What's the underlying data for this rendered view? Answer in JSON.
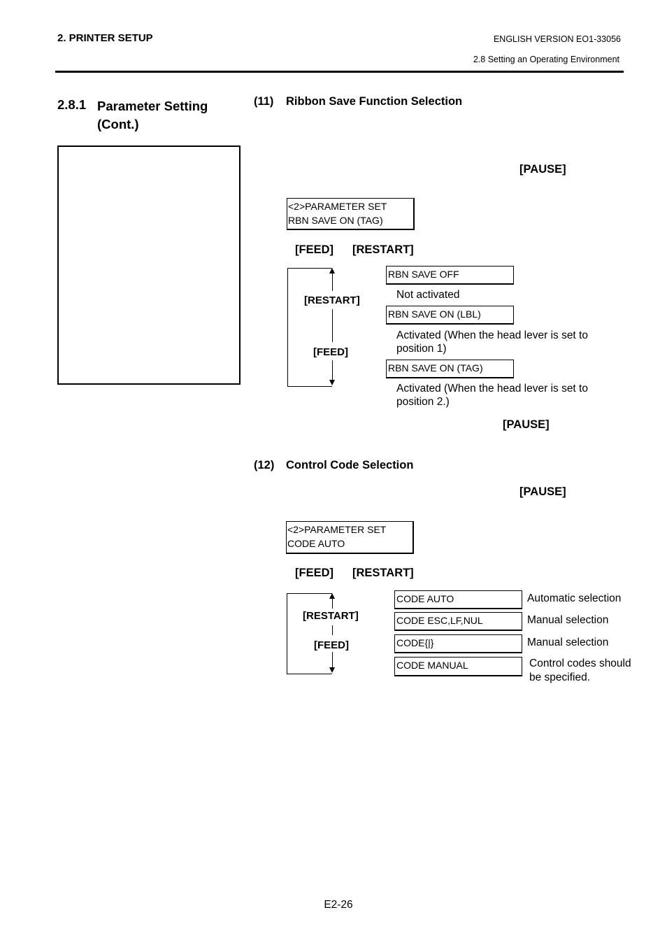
{
  "header": {
    "chapter": "2. PRINTER SETUP",
    "version": "ENGLISH VERSION EO1-33056",
    "section": "2.8 Setting an Operating Environment"
  },
  "section": {
    "number": "2.8.1",
    "title": "Parameter Setting (Cont.)"
  },
  "ribbon_save": {
    "number": "(11)",
    "title": "Ribbon Save Function Selection",
    "pause_key_top": "[PAUSE]",
    "lcd_line1": "<2>PARAMETER SET",
    "lcd_line2": "RBN SAVE  ON (TAG)",
    "feed_key": "[FEED]",
    "restart_key": "[RESTART]",
    "cycle_restart_label": "[RESTART]",
    "cycle_feed_label": "[FEED]",
    "options": [
      {
        "display": "RBN SAVE  OFF",
        "description": "Not activated"
      },
      {
        "display": "RBN SAVE  ON (LBL)",
        "description": "Activated (When the head lever is set to position 1)"
      },
      {
        "display": "RBN SAVE  ON (TAG)",
        "description": "Activated (When the head lever is set to position 2.)"
      }
    ],
    "pause_key_bottom": "[PAUSE]"
  },
  "control_code": {
    "number": "(12)",
    "title": "Control Code Selection",
    "pause_key": "[PAUSE]",
    "lcd_line1": "<2>PARAMETER SET",
    "lcd_line2": "CODE  AUTO",
    "feed_key": "[FEED]",
    "restart_key": "[RESTART]",
    "cycle_restart_label": "[RESTART]",
    "cycle_feed_label": "[FEED]",
    "options": [
      {
        "display": "CODE  AUTO",
        "description": "Automatic selection"
      },
      {
        "display": "CODE ESC,LF,NUL",
        "description": "Manual selection"
      },
      {
        "display": "CODE{|}",
        "description": "Manual selection"
      },
      {
        "display": "CODE MANUAL",
        "description": "Control codes should be specified."
      }
    ]
  },
  "footer": {
    "page_number": "E2-26"
  }
}
